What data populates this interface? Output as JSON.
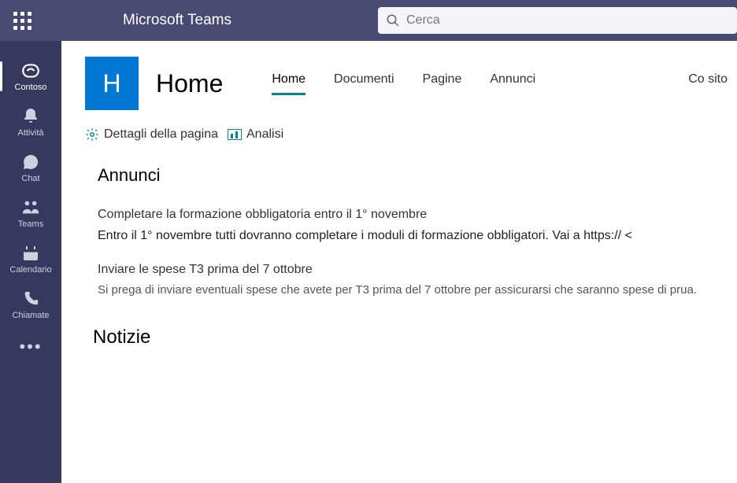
{
  "app_title": "Microsoft Teams",
  "search": {
    "placeholder": "Cerca"
  },
  "sidebar": {
    "items": [
      {
        "label": "Contoso"
      },
      {
        "label": "Attività"
      },
      {
        "label": "Chat"
      },
      {
        "label": "Teams"
      },
      {
        "label": "Calendario"
      },
      {
        "label": "Chiamate"
      }
    ]
  },
  "site": {
    "tile_letter": "H",
    "title": "Home"
  },
  "tabs": {
    "items": [
      {
        "label": "Home"
      },
      {
        "label": "Documenti"
      },
      {
        "label": "Pagine"
      },
      {
        "label": "Annunci"
      }
    ],
    "right": "Co sito"
  },
  "tools": {
    "page_details": "Dettagli della pagina",
    "analytics": "Analisi"
  },
  "announcements": {
    "heading": "Annunci",
    "items": [
      {
        "title": "Completare la formazione obbligatoria entro il 1° novembre",
        "body": "Entro il 1° novembre tutti dovranno completare i moduli di formazione obbligatori. Vai a https:// <"
      },
      {
        "title": "Inviare le spese T3 prima del 7 ottobre",
        "body": "Si prega di inviare eventuali spese che avete per T3 prima del 7 ottobre per assicurarsi che saranno spese di prua."
      }
    ]
  },
  "news": {
    "heading": "Notizie"
  }
}
